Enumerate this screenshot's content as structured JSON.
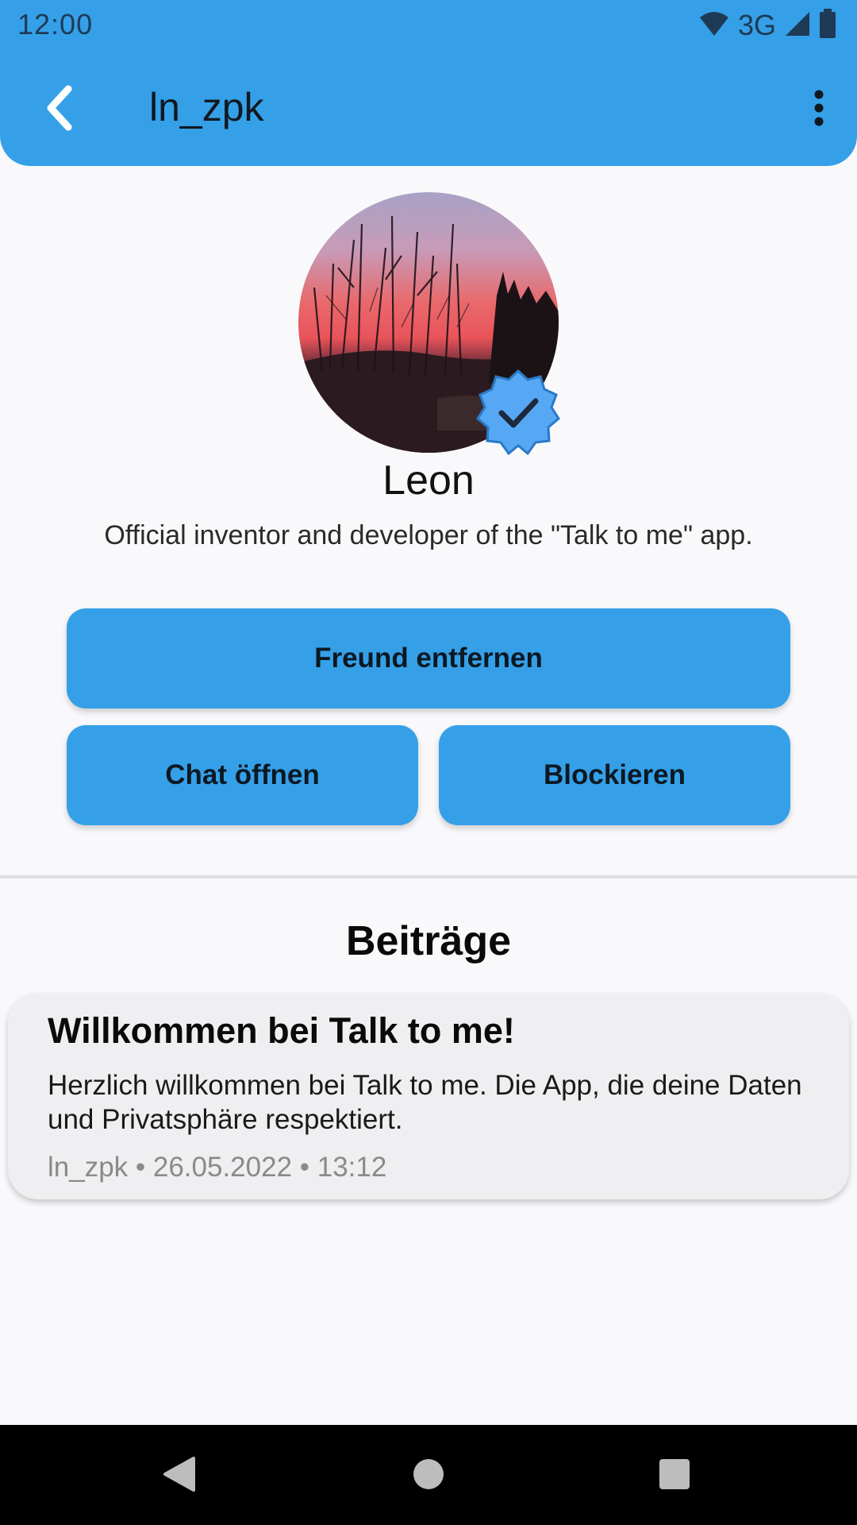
{
  "status_bar": {
    "time": "12:00",
    "network": "3G",
    "icons": [
      "wifi-icon",
      "signal-icon",
      "battery-icon"
    ]
  },
  "app_bar": {
    "title": "ln_zpk",
    "back_icon": "chevron-left-icon",
    "menu_icon": "more-vertical-icon"
  },
  "profile": {
    "name": "Leon",
    "bio": "Official inventor and developer of the \"Talk to me\" app.",
    "verified": true
  },
  "actions": {
    "remove_friend": "Freund entfernen",
    "open_chat": "Chat öffnen",
    "block": "Blockieren"
  },
  "posts_section": {
    "title": "Beiträge",
    "posts": [
      {
        "title": "Willkommen bei Talk to me!",
        "body": "Herzlich willkommen bei Talk to me. Die App, die deine Daten und Privatsphäre respektiert.",
        "meta": "ln_zpk • 26.05.2022 • 13:12"
      }
    ]
  },
  "colors": {
    "accent": "#35a0e8",
    "background": "#f9f9fb",
    "card": "#efeef0",
    "meta_text": "#8a8a8a"
  }
}
